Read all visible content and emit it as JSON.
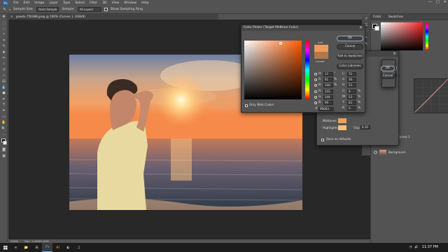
{
  "menubar": {
    "logo": "Ps",
    "items": [
      "File",
      "Edit",
      "Image",
      "Layer",
      "Type",
      "Select",
      "Filter",
      "3D",
      "View",
      "Window",
      "Help"
    ],
    "controls": [
      "—",
      "□",
      "✕"
    ]
  },
  "options": {
    "sample_size_label": "Sample Size:",
    "sample_size_value": "Point Sample",
    "sample_label": "Sample:",
    "sample_value": "All Layers",
    "show_ring_label": "Show Sampling Ring"
  },
  "document": {
    "tab_title": "pexels-750388.jpeg @ 100% (Curves 1, RGB/8)",
    "zoom": "100%",
    "doc_size": "Doc: 1.04M/1.91M"
  },
  "right": {
    "color_tabs": [
      "Color",
      "Swatches"
    ],
    "layer_names": [
      "Curves 1",
      "Background"
    ]
  },
  "color_picker": {
    "title": "Color Picker (Target Midtone Color)",
    "ok": "OK",
    "cancel": "Cancel",
    "add_swatches": "Add to Swatches",
    "color_libraries": "Color Libraries",
    "new_label": "new",
    "current_label": "current",
    "new_color": "#f09a5c",
    "current_color": "#b3774c",
    "only_web": "Only Web Colors",
    "fields": [
      {
        "label": "H:",
        "value": "17",
        "unit": "°"
      },
      {
        "label": "S:",
        "value": "61",
        "unit": "%"
      },
      {
        "label": "B:",
        "value": "100",
        "unit": "%"
      },
      {
        "label": "R:",
        "value": "255",
        "unit": ""
      },
      {
        "label": "G:",
        "value": "144",
        "unit": ""
      },
      {
        "label": "B:",
        "value": "99",
        "unit": ""
      }
    ],
    "fields_right": [
      {
        "label": "L:",
        "value": "72",
        "unit": ""
      },
      {
        "label": "a:",
        "value": "36",
        "unit": ""
      },
      {
        "label": "b:",
        "value": "53",
        "unit": ""
      },
      {
        "label": "C:",
        "value": "0",
        "unit": "%"
      },
      {
        "label": "M:",
        "value": "53",
        "unit": "%"
      },
      {
        "label": "Y:",
        "value": "62",
        "unit": "%"
      },
      {
        "label": "K:",
        "value": "0",
        "unit": "%"
      }
    ],
    "hex_label": "#",
    "hex_value": "ff9063"
  },
  "auto_options": {
    "ok": "OK",
    "cancel": "Cancel",
    "midtones_label": "Midtones:",
    "highlights_label": "Highlights:",
    "midtones_color": "#f0a05c",
    "highlights_color": "#f5c070",
    "clip_label": "Clip:",
    "clip_value": "0.10",
    "save_defaults": "Save as defaults"
  },
  "taskbar": {
    "clock": "11:37 PM",
    "apps": [
      "e",
      "📁",
      "⊞",
      "Ps",
      "Ai",
      "◐",
      "♫"
    ]
  },
  "colors": {
    "ps_blue": "#2a5fa8",
    "dialog_bg": "#535353",
    "canvas_bg": "#282828"
  }
}
